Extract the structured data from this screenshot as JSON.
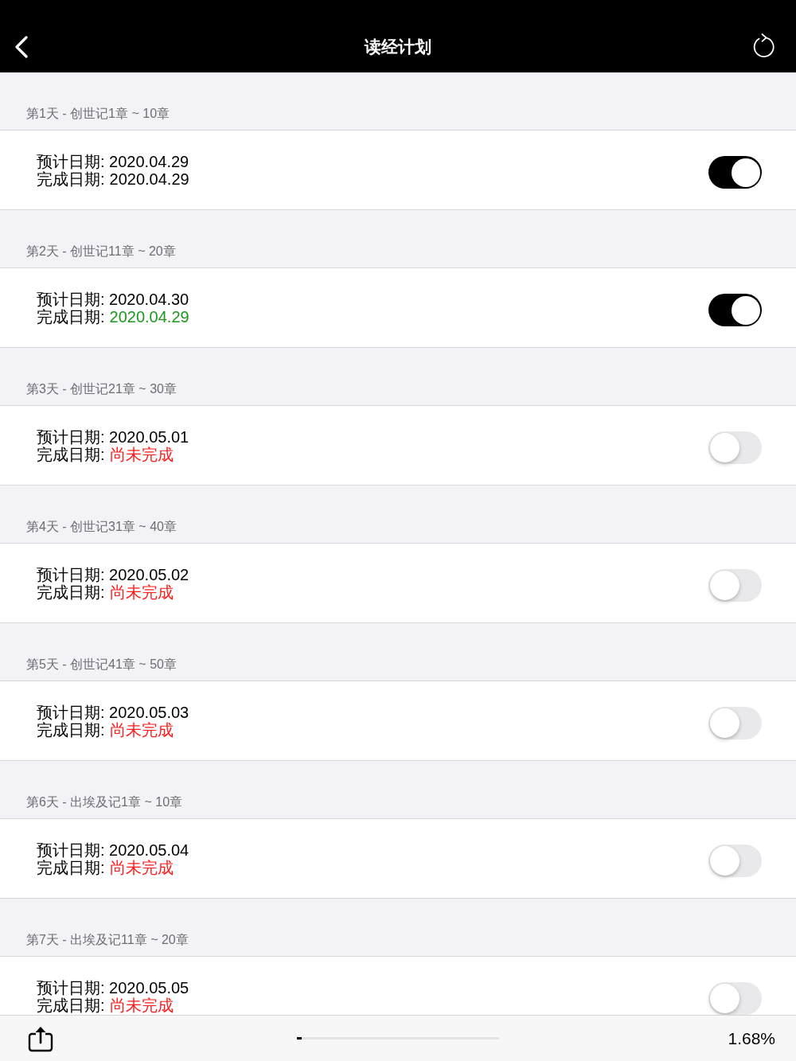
{
  "nav_bar": {
    "title": "读经计划"
  },
  "days": [
    {
      "heading": "第1天 - 创世记1章 ~ 10章",
      "planned": "预计日期: 2020.04.29",
      "completed_label": "完成日期:",
      "completed": "2020.04.29",
      "kind": "on-time",
      "on": true
    },
    {
      "heading": "第2天 - 创世记11章 ~ 20章",
      "planned": "预计日期: 2020.04.30",
      "completed_label": "完成日期:",
      "completed": "2020.04.29",
      "kind": "early",
      "on": true
    },
    {
      "heading": "第3天 - 创世记21章 ~ 30章",
      "planned": "预计日期: 2020.05.01",
      "completed_label": "完成日期:",
      "completed": "尚未完成",
      "kind": "pending",
      "on": false
    },
    {
      "heading": "第4天 - 创世记31章 ~ 40章",
      "planned": "预计日期: 2020.05.02",
      "completed_label": "完成日期:",
      "completed": "尚未完成",
      "kind": "pending",
      "on": false
    },
    {
      "heading": "第5天 - 创世记41章 ~ 50章",
      "planned": "预计日期: 2020.05.03",
      "completed_label": "完成日期:",
      "completed": "尚未完成",
      "kind": "pending",
      "on": false
    },
    {
      "heading": "第6天 - 出埃及记1章 ~ 10章",
      "planned": "预计日期: 2020.05.04",
      "completed_label": "完成日期:",
      "completed": "尚未完成",
      "kind": "pending",
      "on": false
    },
    {
      "heading": "第7天 - 出埃及记11章 ~ 20章",
      "planned": "预计日期: 2020.05.05",
      "completed_label": "完成日期:",
      "completed": "尚未完成",
      "kind": "pending",
      "on": false
    }
  ],
  "progress": {
    "level": 0.0168,
    "reading": "1.68%"
  }
}
